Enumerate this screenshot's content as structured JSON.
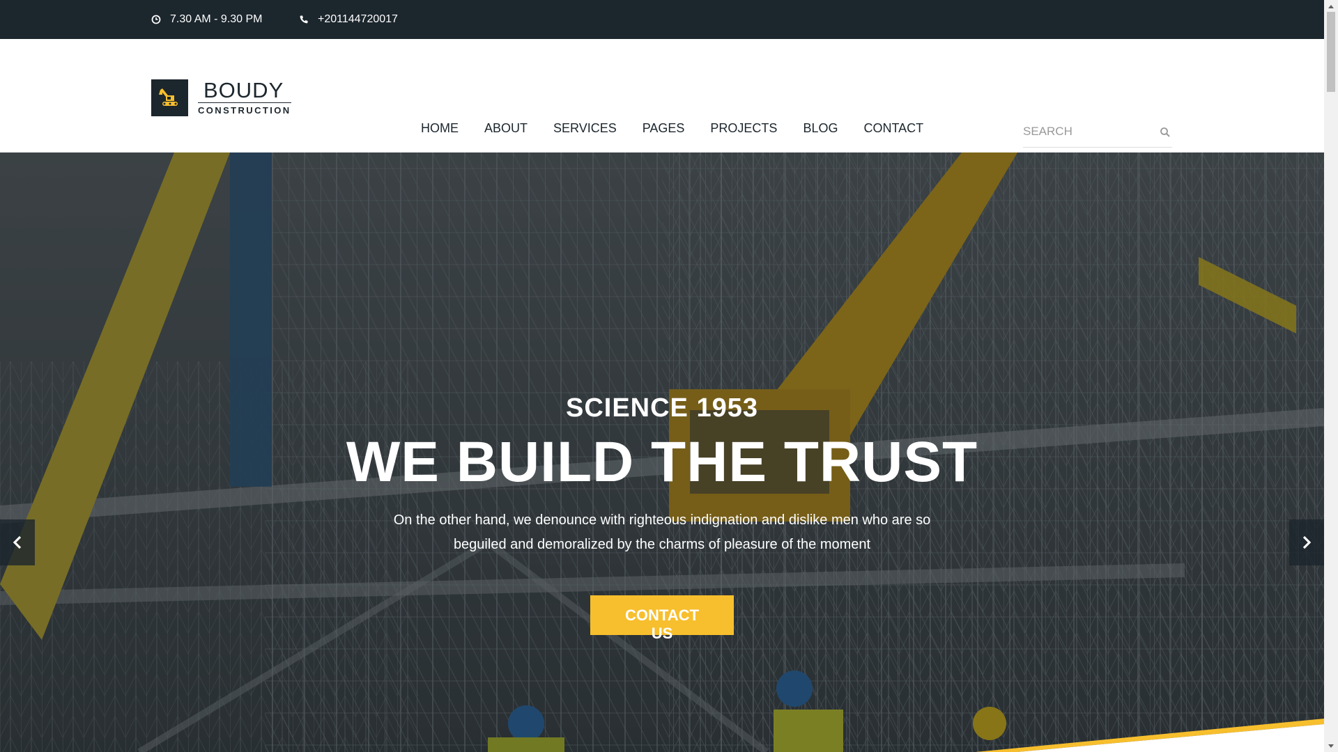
{
  "topbar": {
    "hours": "7.30 AM - 9.30 PM",
    "phone": "+201144720017"
  },
  "logo": {
    "brand": "BOUDY",
    "sub": "CONSTRUCTION"
  },
  "nav": {
    "items": [
      "HOME",
      "ABOUT",
      "SERVICES",
      "PAGES",
      "PROJECTS",
      "BLOG",
      "CONTACT"
    ]
  },
  "search": {
    "placeholder": "SEARCH"
  },
  "hero": {
    "eyebrow": "SCIENCE 1953",
    "headline": "WE BUILD THE TRUST",
    "description_line1": "On the other hand, we denounce with righteous indignation and dislike men who are so",
    "description_line2": "beguiled and demoralized by the charms of pleasure of the moment",
    "cta": "CONTACT US"
  },
  "colors": {
    "dark": "#1c262d",
    "accent": "#f7bf2d"
  },
  "icons": {
    "hours": "clock-icon",
    "phone": "phone-icon",
    "search": "search-icon",
    "prev": "chevron-left-icon",
    "next": "chevron-right-icon"
  }
}
